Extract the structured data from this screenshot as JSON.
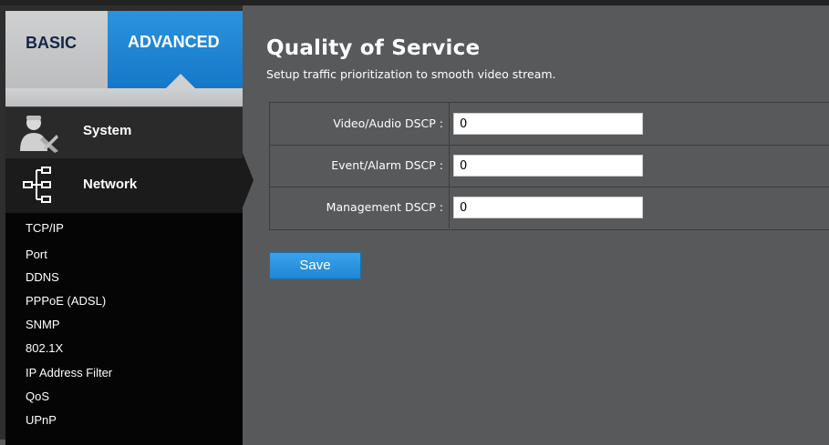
{
  "tabs": {
    "basic": "BASIC",
    "advanced": "ADVANCED"
  },
  "sidebar": {
    "system": {
      "label": "System",
      "icon": "system-user-icon"
    },
    "network": {
      "label": "Network",
      "icon": "network-tree-icon"
    },
    "sub_items": [
      "TCP/IP",
      "Port",
      "DDNS",
      "PPPoE (ADSL)",
      "SNMP",
      "802.1X",
      "IP Address Filter",
      "QoS",
      "UPnP"
    ]
  },
  "page": {
    "title": "Quality of Service",
    "subtitle": "Setup traffic prioritization to smooth video stream."
  },
  "fields": [
    {
      "label": "Video/Audio DSCP :",
      "value": "0"
    },
    {
      "label": "Event/Alarm DSCP :",
      "value": "0"
    },
    {
      "label": "Management DSCP :",
      "value": "0"
    }
  ],
  "save_label": "Save",
  "colors": {
    "accent": "#1f86d4",
    "sidebar_bg": "#050505",
    "main_bg": "#58595b"
  }
}
